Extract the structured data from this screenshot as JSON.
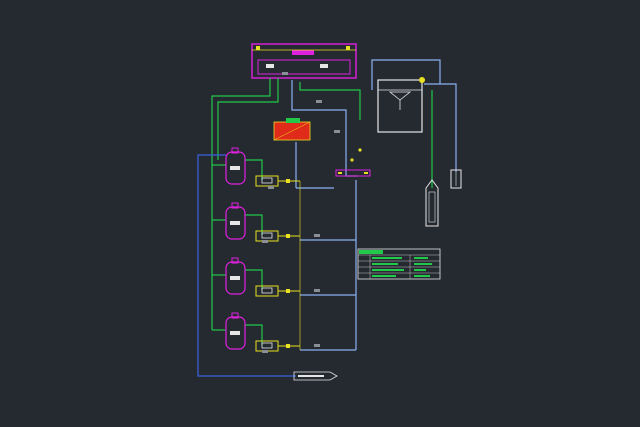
{
  "drawing": {
    "colors": {
      "background": "#252a31",
      "magenta": "#e020e0",
      "green": "#22c84a",
      "blue": "#3a62e0",
      "light_blue": "#8ab0f0",
      "yellow": "#e8e020",
      "white": "#e6e6e6",
      "red": "#e02a1a"
    },
    "components": {
      "pool": "swimming-pool",
      "balance_tank": "balance-tank",
      "heater": "heater-unit",
      "filters": [
        "sand-filter-1",
        "sand-filter-2",
        "sand-filter-3",
        "sand-filter-4"
      ],
      "pumps": [
        "pump-1",
        "pump-2",
        "pump-3",
        "pump-4"
      ],
      "dosing": [
        "chemical-dosing-tank-1",
        "chemical-dosing-tank-2"
      ]
    }
  }
}
